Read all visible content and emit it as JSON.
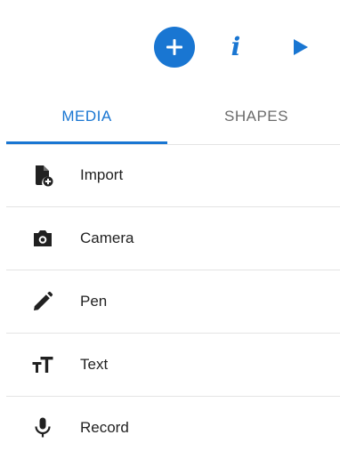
{
  "colors": {
    "accent": "#1976d2",
    "icon": "#212121",
    "inactive_tab": "#6b6b6b",
    "divider": "#e4e4e4"
  },
  "toolbar": {
    "add_icon": "plus-icon",
    "info_icon": "info-icon",
    "info_glyph": "i",
    "play_icon": "play-icon"
  },
  "tabs": [
    {
      "label": "MEDIA",
      "selected": true
    },
    {
      "label": "SHAPES",
      "selected": false
    }
  ],
  "menu": {
    "items": [
      {
        "label": "Import",
        "icon": "file-add-icon"
      },
      {
        "label": "Camera",
        "icon": "camera-icon"
      },
      {
        "label": "Pen",
        "icon": "pen-icon"
      },
      {
        "label": "Text",
        "icon": "text-size-icon"
      },
      {
        "label": "Record",
        "icon": "microphone-icon"
      }
    ]
  }
}
